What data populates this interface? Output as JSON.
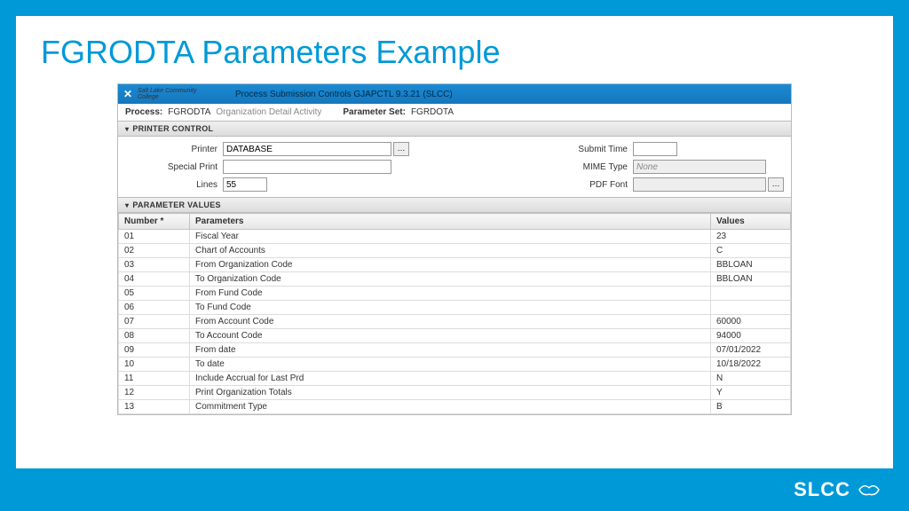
{
  "slide": {
    "title": "FGRODTA Parameters Example"
  },
  "app": {
    "title": "Process Submission Controls GJAPCTL 9.3.21 (SLCC)",
    "logo_text": "Salt Lake Community College"
  },
  "meta": {
    "process_label": "Process:",
    "process_value": "FGRODTA",
    "process_desc": "Organization Detail Activity",
    "paramset_label": "Parameter Set:",
    "paramset_value": "FGRDOTA"
  },
  "sections": {
    "printer_control": "PRINTER CONTROL",
    "parameter_values": "PARAMETER VALUES"
  },
  "printer": {
    "printer_label": "Printer",
    "printer_value": "DATABASE",
    "special_label": "Special Print",
    "special_value": "",
    "lines_label": "Lines",
    "lines_value": "55",
    "submit_label": "Submit Time",
    "submit_value": "",
    "mime_label": "MIME Type",
    "mime_placeholder": "None",
    "pdf_label": "PDF Font",
    "pdf_value": ""
  },
  "table": {
    "headers": {
      "number": "Number *",
      "parameters": "Parameters",
      "values": "Values"
    },
    "rows": [
      {
        "num": "01",
        "param": "Fiscal Year",
        "val": "23"
      },
      {
        "num": "02",
        "param": "Chart of Accounts",
        "val": "C"
      },
      {
        "num": "03",
        "param": "From Organization Code",
        "val": "BBLOAN"
      },
      {
        "num": "04",
        "param": "To Organization Code",
        "val": "BBLOAN"
      },
      {
        "num": "05",
        "param": "From Fund Code",
        "val": ""
      },
      {
        "num": "06",
        "param": "To Fund Code",
        "val": ""
      },
      {
        "num": "07",
        "param": "From Account Code",
        "val": "60000"
      },
      {
        "num": "08",
        "param": "To Account Code",
        "val": "94000"
      },
      {
        "num": "09",
        "param": "From date",
        "val": "07/01/2022"
      },
      {
        "num": "10",
        "param": "To date",
        "val": "10/18/2022"
      },
      {
        "num": "11",
        "param": "Include Accrual for Last Prd",
        "val": "N"
      },
      {
        "num": "12",
        "param": "Print Organization Totals",
        "val": "Y"
      },
      {
        "num": "13",
        "param": "Commitment Type",
        "val": "B"
      }
    ]
  },
  "footer": {
    "brand": "SLCC"
  }
}
